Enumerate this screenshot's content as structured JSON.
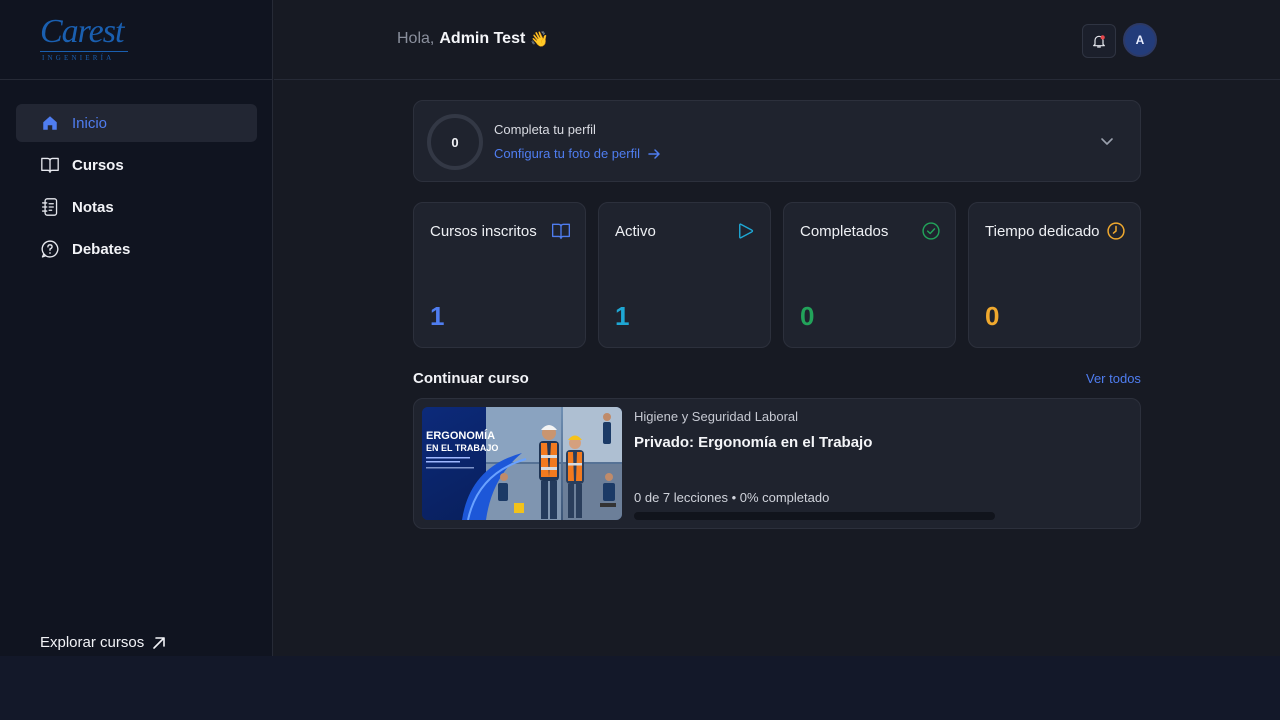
{
  "brand": {
    "logo_word": "Carest",
    "logo_sub": "INGENIERÍA",
    "color": "#1a5fb0"
  },
  "sidebar": {
    "items": [
      {
        "label": "Inicio",
        "icon": "home-icon",
        "active": true
      },
      {
        "label": "Cursos",
        "icon": "book-icon",
        "active": false
      },
      {
        "label": "Notas",
        "icon": "notebook-icon",
        "active": false
      },
      {
        "label": "Debates",
        "icon": "help-circle-icon",
        "active": false
      }
    ],
    "explore_label": "Explorar cursos"
  },
  "header": {
    "greeting": "Hola,",
    "user_name": "Admin Test",
    "wave": "👋",
    "avatar_initial": "A",
    "notification_icon": "bell-icon"
  },
  "profile": {
    "progress": "0",
    "title": "Completa tu perfil",
    "link": "Configura tu foto de perfil"
  },
  "stats": [
    {
      "label": "Cursos inscritos",
      "value": "1",
      "icon": "book-open-icon",
      "color": "#4f7df0"
    },
    {
      "label": "Activo",
      "value": "1",
      "icon": "play-icon",
      "color": "#1ea7d4"
    },
    {
      "label": "Completados",
      "value": "0",
      "icon": "check-circle-icon",
      "color": "#22a35a"
    },
    {
      "label": "Tiempo dedicado",
      "value": "0",
      "icon": "clock-icon",
      "color": "#f0a92e"
    }
  ],
  "continue": {
    "title": "Continuar curso",
    "see_all": "Ver todos",
    "course": {
      "category": "Higiene y Seguridad Laboral",
      "title": "Privado: Ergonomía en el Trabajo",
      "lessons_done": "0",
      "lessons_total": "7",
      "progress_text": "0 de 7 lecciones • 0% completado",
      "progress_fraction": 0,
      "thumb_line1": "ERGONOMÍA",
      "thumb_line2": "EN EL TRABAJO"
    }
  },
  "colors": {
    "accent": "#4f7df0",
    "bg": "#171a23",
    "sidebar": "#101420",
    "card": "#1f232e"
  }
}
